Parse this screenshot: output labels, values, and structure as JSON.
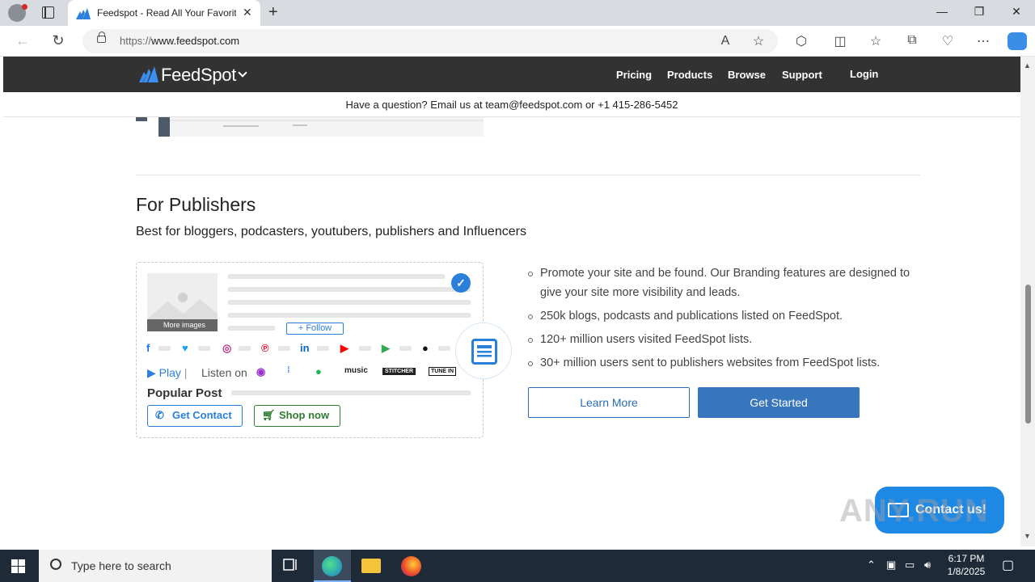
{
  "browser": {
    "tab_title": "Feedspot - Read All Your Favorite",
    "url_prefix": "https://",
    "url_host": "www.feedspot.com",
    "tab_close": "✕",
    "new_tab": "+",
    "win_min": "—",
    "win_max": "❐",
    "win_close": "✕"
  },
  "header": {
    "brand": "FeedSpot",
    "nav": [
      "Pricing",
      "Products",
      "Browse",
      "Support",
      "Login"
    ]
  },
  "question_bar": "Have a question? Email us at team@feedspot.com or +1 415-286-5452",
  "section": {
    "title": "For Publishers",
    "subtitle": "Best for bloggers, podcasters, youtubers, publishers and Influencers"
  },
  "card": {
    "more_images": "More images",
    "follow": "+ Follow",
    "play": "Play",
    "listen_on": "Listen on",
    "popular_post": "Popular Post",
    "get_contact": "Get Contact",
    "shop_now": "Shop now",
    "music": "music",
    "stitcher": "STITCHER",
    "tunein": "TUNE IN"
  },
  "bullets": [
    "Promote your site and be found. Our Branding features are designed to give your site more visibility and leads.",
    "250k blogs, podcasts and publications listed on FeedSpot.",
    "120+ million users visited FeedSpot lists.",
    "30+ million users sent to publishers websites from FeedSpot lists."
  ],
  "buttons": {
    "learn_more": "Learn More",
    "get_started": "Get Started"
  },
  "contact_widget": "Contact us!",
  "watermark": "ANY.RUN",
  "taskbar": {
    "search_placeholder": "Type here to search",
    "time": "6:17 PM",
    "date": "1/8/2025"
  },
  "colors": {
    "header_bg": "#323232",
    "accent_blue": "#2a7fd9",
    "get_started_bg": "#3776bd",
    "contact_widget_bg": "#1e88e5"
  }
}
